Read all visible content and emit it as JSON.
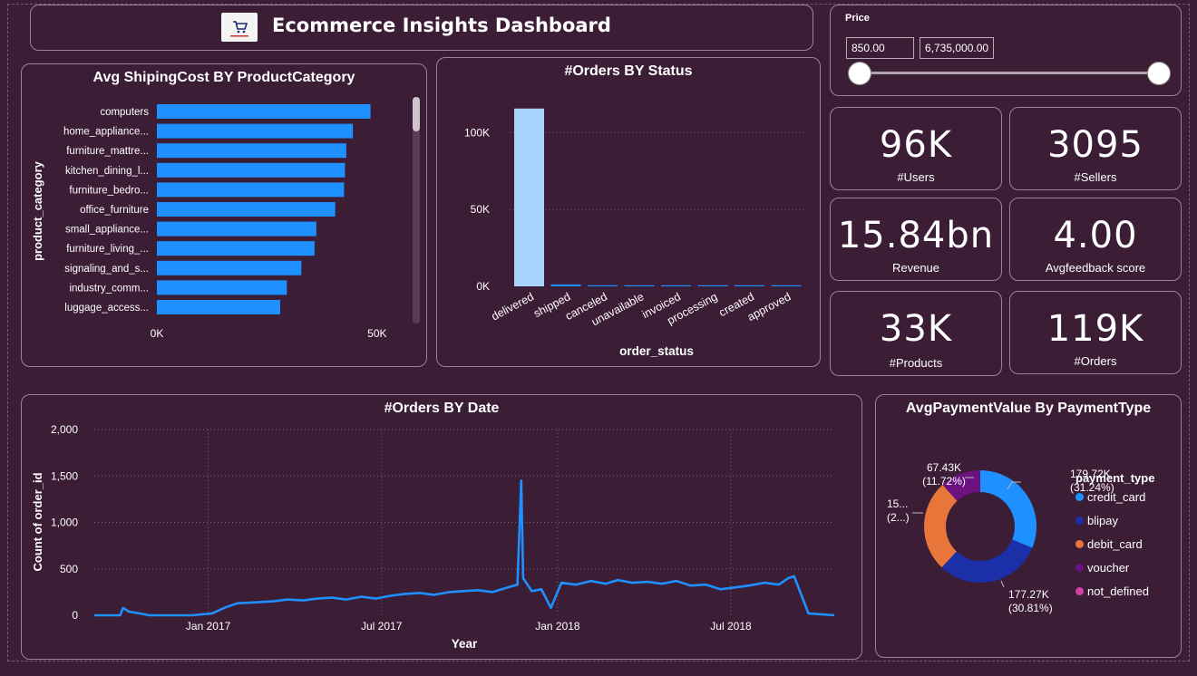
{
  "header": {
    "title": "Ecommerce Insights Dashboard",
    "logo_icon": "cart-logo-icon"
  },
  "price_filter": {
    "label": "Price",
    "min_value": "850.00",
    "max_value": "6,735,000.00",
    "range_low": 0,
    "range_high": 1
  },
  "kpis": [
    {
      "value": "96K",
      "label": "#Users"
    },
    {
      "value": "3095",
      "label": "#Sellers"
    },
    {
      "value": "15.84bn",
      "label": "Revenue"
    },
    {
      "value": "4.00",
      "label": "Avgfeedback score"
    },
    {
      "value": "33K",
      "label": "#Products"
    },
    {
      "value": "119K",
      "label": "#Orders"
    }
  ],
  "colors": {
    "background": "#3b1d36",
    "bar_blue": "#1e90ff",
    "bar_light": "#a9d4ff",
    "line": "#1e90ff",
    "credit_card": "#1e90ff",
    "blipay": "#1a2fa8",
    "debit_card": "#e8763a",
    "voucher": "#6b1280",
    "not_defined": "#d63fa8"
  },
  "chart_data": [
    {
      "type": "bar",
      "orientation": "horizontal",
      "title": "Avg ShipingCost BY ProductCategory",
      "ylabel": "product_category",
      "xlabel": "",
      "categories": [
        "computers",
        "home_appliance...",
        "furniture_mattre...",
        "kitchen_dining_l...",
        "furniture_bedro...",
        "office_furniture",
        "small_appliance...",
        "furniture_living_...",
        "signaling_and_s...",
        "industry_comm...",
        "luggage_access..."
      ],
      "values": [
        48500,
        44500,
        43000,
        42700,
        42500,
        40500,
        36200,
        35800,
        32800,
        29500,
        28000
      ],
      "xlim": [
        0,
        56000
      ],
      "xticks": [
        {
          "v": 0,
          "label": "0K"
        },
        {
          "v": 50000,
          "label": "50K"
        }
      ]
    },
    {
      "type": "bar",
      "title": "#Orders BY Status",
      "xlabel": "order_status",
      "ylabel": "",
      "categories": [
        "delivered",
        "shipped",
        "canceled",
        "unavailable",
        "invoiced",
        "processing",
        "created",
        "approved"
      ],
      "values": [
        115700,
        1250,
        620,
        610,
        315,
        300,
        5,
        2
      ],
      "ylim": [
        0,
        125000
      ],
      "yticks": [
        {
          "v": 0,
          "label": "0K"
        },
        {
          "v": 50000,
          "label": "50K"
        },
        {
          "v": 100000,
          "label": "100K"
        }
      ]
    },
    {
      "type": "line",
      "title": "#Orders BY Date",
      "xlabel": "Year",
      "ylabel": "Count of order_id",
      "ylim": [
        0,
        2000
      ],
      "yticks": [
        {
          "v": 0,
          "label": "0"
        },
        {
          "v": 500,
          "label": "500"
        },
        {
          "v": 1000,
          "label": "1,000"
        },
        {
          "v": 1500,
          "label": "1,500"
        },
        {
          "v": 2000,
          "label": "2,000"
        }
      ],
      "xticks": [
        {
          "date": "2017-01-01",
          "label": "Jan 2017"
        },
        {
          "date": "2017-07-01",
          "label": "Jul 2017"
        },
        {
          "date": "2018-01-01",
          "label": "Jan 2018"
        },
        {
          "date": "2018-07-01",
          "label": "Jul 2018"
        }
      ],
      "x_range": [
        "2016-09-04",
        "2018-10-17"
      ],
      "x": [
        "2016-09-04",
        "2016-10-01",
        "2016-10-04",
        "2016-10-10",
        "2016-11-01",
        "2016-12-15",
        "2017-01-05",
        "2017-01-20",
        "2017-02-01",
        "2017-02-20",
        "2017-03-10",
        "2017-03-25",
        "2017-04-10",
        "2017-04-25",
        "2017-05-10",
        "2017-05-25",
        "2017-06-10",
        "2017-06-25",
        "2017-07-10",
        "2017-07-25",
        "2017-08-10",
        "2017-08-25",
        "2017-09-10",
        "2017-09-25",
        "2017-10-10",
        "2017-10-25",
        "2017-11-10",
        "2017-11-20",
        "2017-11-24",
        "2017-11-26",
        "2017-12-05",
        "2017-12-15",
        "2017-12-25",
        "2018-01-05",
        "2018-01-20",
        "2018-02-05",
        "2018-02-20",
        "2018-03-05",
        "2018-03-20",
        "2018-04-05",
        "2018-04-20",
        "2018-05-05",
        "2018-05-20",
        "2018-06-05",
        "2018-06-20",
        "2018-07-05",
        "2018-07-20",
        "2018-08-05",
        "2018-08-20",
        "2018-08-30",
        "2018-09-05",
        "2018-09-20",
        "2018-10-17"
      ],
      "values": [
        0,
        0,
        80,
        40,
        0,
        0,
        20,
        90,
        130,
        140,
        150,
        170,
        160,
        180,
        190,
        170,
        200,
        180,
        210,
        230,
        240,
        220,
        250,
        260,
        270,
        250,
        300,
        330,
        1450,
        400,
        260,
        280,
        80,
        350,
        330,
        370,
        340,
        380,
        350,
        360,
        340,
        370,
        320,
        330,
        280,
        300,
        320,
        350,
        330,
        400,
        420,
        20,
        0
      ]
    },
    {
      "type": "pie",
      "donut": true,
      "title": "AvgPaymentValue By PaymentType",
      "legend_title": "payment_type",
      "legend_position": "right",
      "slices": [
        {
          "name": "credit_card",
          "value": 179720,
          "label_value": "179.72K",
          "label_pct": "(31.24%)"
        },
        {
          "name": "blipay",
          "value": 177270,
          "label_value": "177.27K",
          "label_pct": "(30.81%)"
        },
        {
          "name": "debit_card",
          "value": 151000,
          "label_value": "15...",
          "label_pct": "(2...)"
        },
        {
          "name": "voucher",
          "value": 67430,
          "label_value": "67.43K",
          "label_pct": "(11.72%)"
        },
        {
          "name": "not_defined",
          "value": 0,
          "label_value": "",
          "label_pct": ""
        }
      ]
    }
  ]
}
